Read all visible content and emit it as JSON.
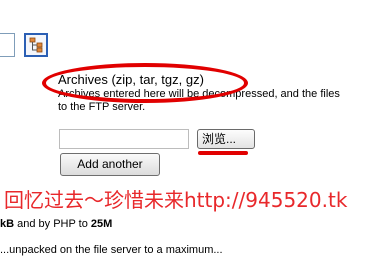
{
  "archives": {
    "title": "Archives (zip, tar, tgz, gz)",
    "description_line1": "Archives entered here will be decompressed, and the files",
    "description_line2": "to the FTP server."
  },
  "upload": {
    "browse_label": "浏览...",
    "add_another_label": "Add another"
  },
  "watermark": "回忆过去～珍惜未来http://945520.tk",
  "limits": {
    "prefix_bold": "kB",
    "middle": " and by PHP to ",
    "php_limit": "25M"
  },
  "clipped_line": "...unpacked on the file server to a maximum...",
  "colors": {
    "annotation_red": "#e10000",
    "watermark_red": "#e8282b",
    "icon_blue": "#2b5fb4"
  },
  "icons": {
    "tree": "sitemap-tree-icon"
  }
}
